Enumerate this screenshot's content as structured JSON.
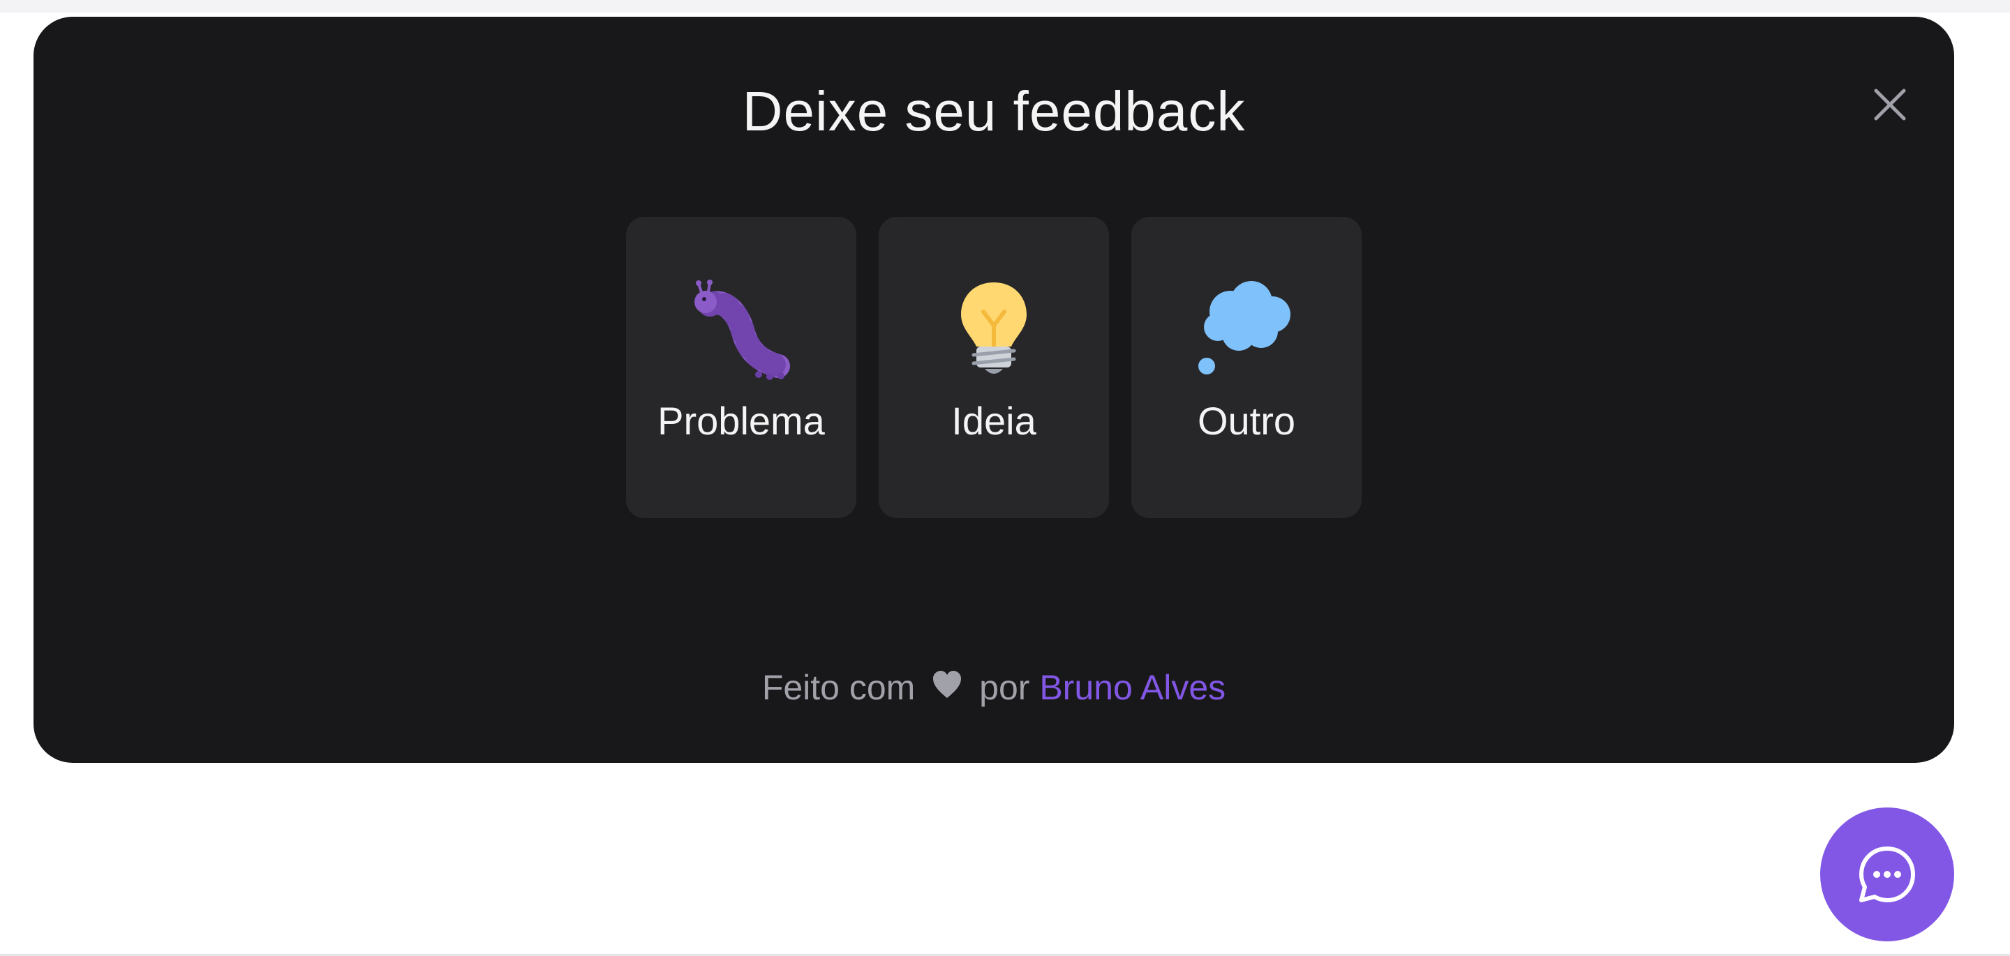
{
  "widget": {
    "title": "Deixe seu feedback",
    "close_icon": "close-icon",
    "feedback_types": [
      {
        "label": "Problema",
        "icon": "caterpillar-icon",
        "color": "#8b5cc7"
      },
      {
        "label": "Ideia",
        "icon": "lightbulb-icon",
        "color": "#ffd871"
      },
      {
        "label": "Outro",
        "icon": "thought-bubble-icon",
        "color": "#7fc1fa"
      }
    ],
    "footer": {
      "prefix": "Feito com",
      "heart_icon": "heart-icon",
      "middle": "por",
      "author": "Bruno Alves"
    }
  },
  "fab": {
    "icon": "chat-bubble-icon"
  },
  "colors": {
    "widget_bg": "#18181b",
    "card_bg": "#27272a",
    "brand": "#8257e5",
    "text": "#f4f4f5",
    "muted": "#a1a1aa"
  }
}
